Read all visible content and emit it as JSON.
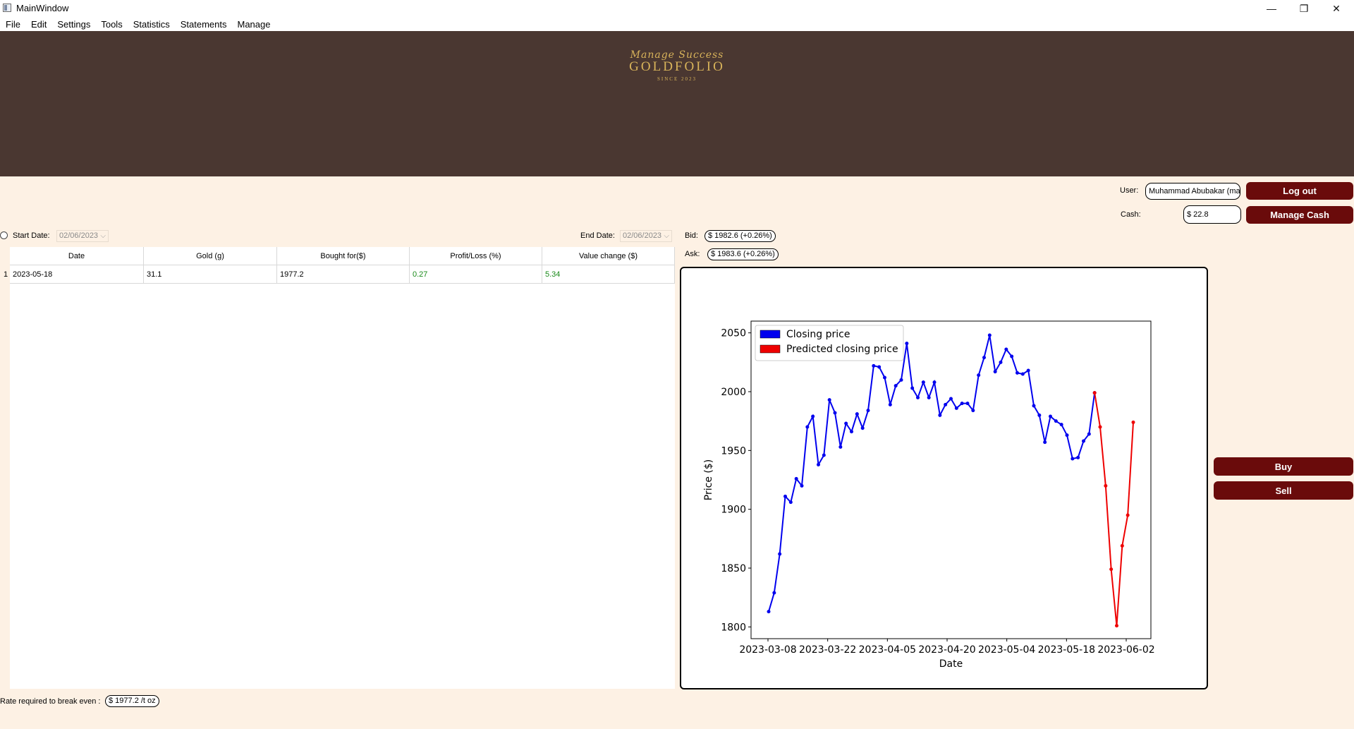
{
  "window": {
    "title": "MainWindow",
    "minimize_glyph": "—",
    "restore_glyph": "❐",
    "close_glyph": "✕"
  },
  "menu": [
    "File",
    "Edit",
    "Settings",
    "Tools",
    "Statistics",
    "Statements",
    "Manage"
  ],
  "brand": {
    "script": "Manage Success",
    "name": "GOLDFOLIO",
    "since": "SINCE 2023",
    "banner_color": "#4a3731",
    "gold_color": "#d8b35a"
  },
  "user": {
    "user_label": "User:",
    "user_value": "Muhammad Abubakar (ma)",
    "cash_label": "Cash:",
    "cash_value": "$ 22.8",
    "logout_label": "Log out",
    "manage_cash_label": "Manage Cash"
  },
  "filters": {
    "start_label": "Start Date:",
    "start_value": "02/06/2023",
    "end_label": "End Date:",
    "end_value": "02/06/2023"
  },
  "quotes": {
    "bid_label": "Bid:",
    "bid_value": "$ 1982.6 (+0.26%)",
    "ask_label": "Ask:",
    "ask_value": "$ 1983.6 (+0.26%)"
  },
  "table": {
    "columns": [
      "Date",
      "Gold (g)",
      "Bought for($)",
      "Profit/Loss (%)",
      "Value change ($)"
    ],
    "rows": [
      {
        "index": "1",
        "date": "2023-05-18",
        "gold": "31.1",
        "bought": "1977.2",
        "profit": "0.27",
        "value_change": "5.34"
      }
    ]
  },
  "actions": {
    "buy_label": "Buy",
    "sell_label": "Sell",
    "button_color": "#6a0b0b"
  },
  "footer": {
    "breakeven_label": "Rate required to break even :",
    "breakeven_value": "$ 1977.2 /t oz"
  },
  "chart_data": {
    "type": "line",
    "xlabel": "Date",
    "ylabel": "Price ($)",
    "ylim": [
      1790,
      2060
    ],
    "yticks": [
      1800,
      1850,
      1900,
      1950,
      2000,
      2050
    ],
    "xticks": [
      "2023-03-08",
      "2023-03-22",
      "2023-04-05",
      "2023-04-20",
      "2023-05-04",
      "2023-05-18",
      "2023-06-02"
    ],
    "legend_position": "top-left",
    "series": [
      {
        "name": "Closing price",
        "color": "#0000ee",
        "values": [
          1813,
          1829,
          1862,
          1911,
          1906,
          1926,
          1920,
          1970,
          1979,
          1938,
          1946,
          1993,
          1982,
          1953,
          1973,
          1966,
          1981,
          1969,
          1984,
          2022,
          2021,
          2012,
          1989,
          2005,
          2010,
          2041,
          2003,
          1995,
          2008,
          1995,
          2008,
          1980,
          1989,
          1994,
          1986,
          1990,
          1990,
          1984,
          2014,
          2029,
          2048,
          2017,
          2025,
          2036,
          2030,
          2016,
          2015,
          2018,
          1988,
          1980,
          1957,
          1979,
          1975,
          1972,
          1963,
          1943,
          1944,
          1958,
          1964,
          1999
        ]
      },
      {
        "name": "Predicted closing price",
        "color": "#ee0000",
        "values": [
          1999,
          1970,
          1920,
          1849,
          1801,
          1869,
          1895,
          1974
        ]
      }
    ]
  }
}
